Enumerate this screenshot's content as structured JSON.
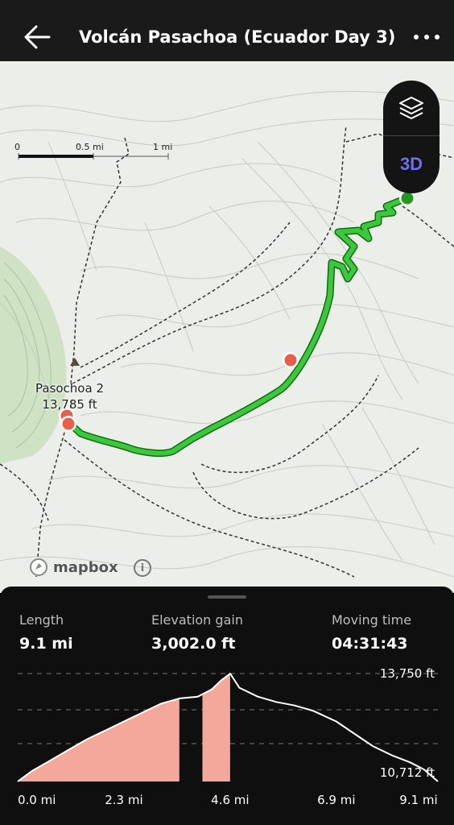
{
  "header": {
    "title": "Volcán Pasachoa (Ecuador Day 3)",
    "back_icon": "arrow-left-icon",
    "more_icon": "more-horizontal-icon"
  },
  "map": {
    "scale": {
      "labels": [
        "0",
        "0.5 mi",
        "1 mi"
      ]
    },
    "layers_icon": "layers-icon",
    "mode_3d_label": "3D",
    "peak": {
      "name": "Pasochoa 2",
      "elevation": "13,785 ft"
    },
    "attribution": "mapbox",
    "info_icon": "i",
    "route_color": "#3cc83c",
    "marker_color": "#e8604c"
  },
  "stats": {
    "length": {
      "label": "Length",
      "value": "9.1 mi"
    },
    "elevation_gain": {
      "label": "Elevation gain",
      "value": "3,002.0 ft"
    },
    "moving_time": {
      "label": "Moving time",
      "value": "04:31:43"
    }
  },
  "chart_data": {
    "type": "area",
    "x_tick_labels": [
      "0.0 mi",
      "2.3 mi",
      "4.6 mi",
      "6.9 mi",
      "9.1 mi"
    ],
    "y_tick_labels": [
      "13,750 ft",
      "10,712 ft"
    ],
    "ylim": [
      10712,
      13750
    ],
    "xlim": [
      0,
      9.1
    ],
    "x": [
      0,
      0.3,
      0.7,
      1.1,
      1.5,
      1.9,
      2.3,
      2.7,
      3.1,
      3.5,
      3.9,
      4.2,
      4.4,
      4.6,
      4.8,
      5.2,
      5.6,
      6.0,
      6.4,
      6.9,
      7.3,
      7.7,
      8.1,
      8.5,
      8.8,
      9.1
    ],
    "y": [
      10712,
      11000,
      11300,
      11600,
      11900,
      12150,
      12400,
      12650,
      12900,
      13050,
      13100,
      13300,
      13550,
      13750,
      13350,
      13100,
      12950,
      12850,
      12700,
      12400,
      12050,
      11700,
      11450,
      11250,
      11050,
      10712
    ],
    "highlight_ranges": [
      [
        0,
        3.5
      ],
      [
        4.0,
        4.6
      ]
    ],
    "highlight_color": "#f4a79b",
    "line_color": "#ffffff",
    "grid": true
  }
}
